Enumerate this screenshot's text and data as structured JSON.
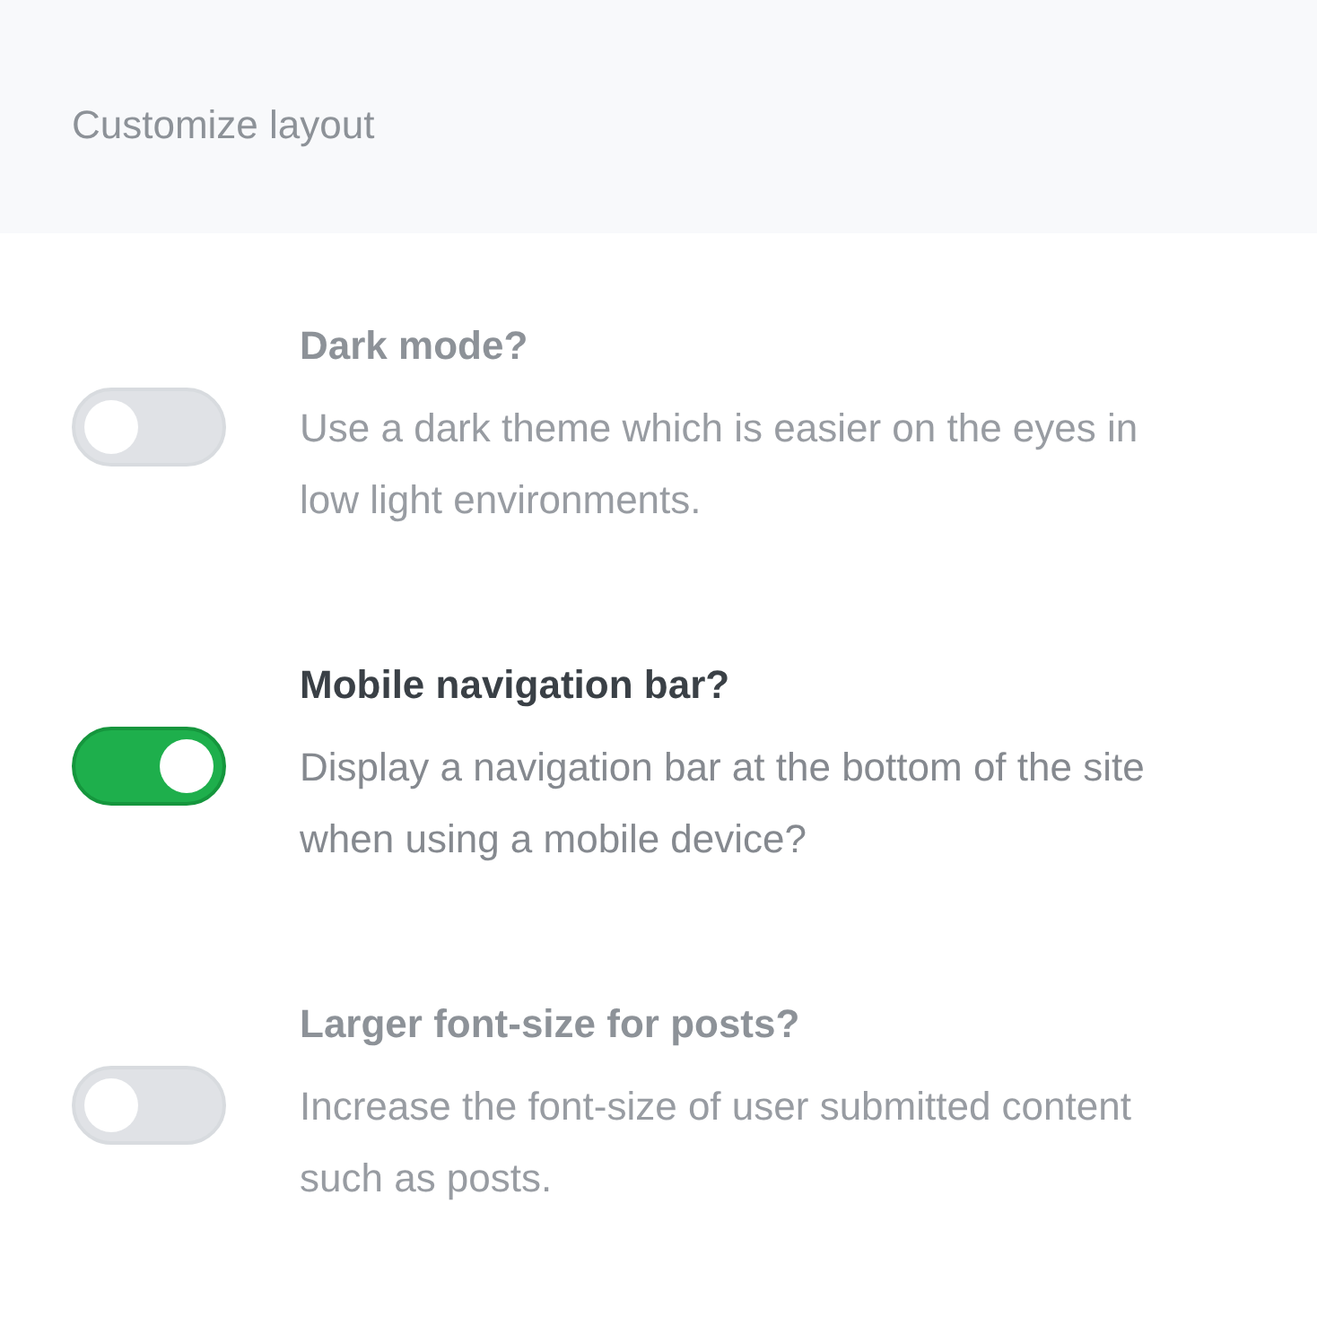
{
  "header": {
    "title": "Customize layout",
    "dimmed": true
  },
  "settings": [
    {
      "title": "Dark mode?",
      "description": "Use a dark theme which is easier on the eyes in low light environments.",
      "on": false,
      "dimmed": true
    },
    {
      "title": "Mobile navigation bar?",
      "description": "Display a navigation bar at the bottom of the site when using a mobile device?",
      "on": true,
      "dimmed": false
    },
    {
      "title": "Larger font-size for posts?",
      "description": "Increase the font-size of user submitted content such as posts.",
      "on": false,
      "dimmed": true
    }
  ]
}
